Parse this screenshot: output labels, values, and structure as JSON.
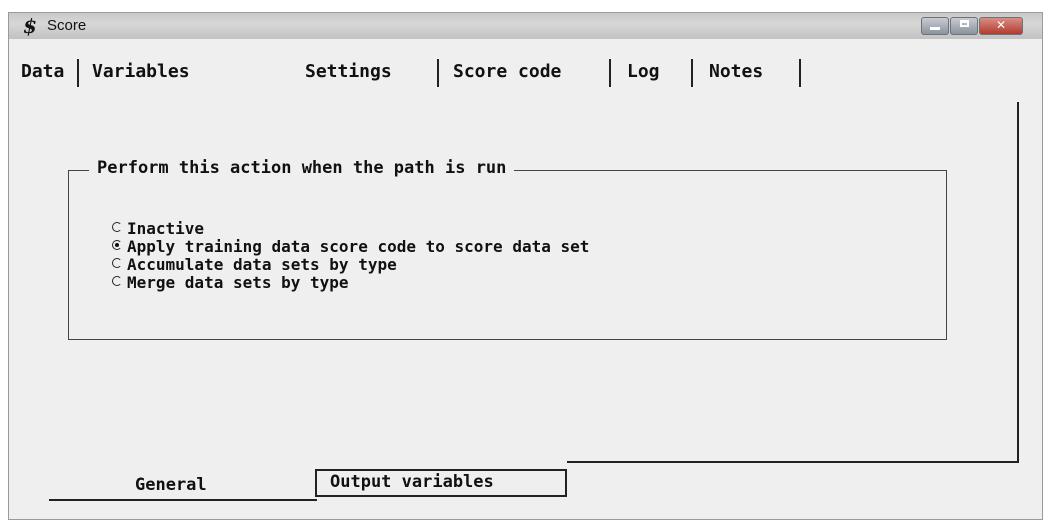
{
  "window": {
    "title": "Score",
    "icon": "sas-dollar-icon",
    "icon_glyph": "$",
    "controls": [
      "minimize",
      "maximize",
      "close"
    ]
  },
  "tabs": [
    {
      "label": "Data",
      "active": false
    },
    {
      "label": "Variables",
      "active": false
    },
    {
      "label": "Settings",
      "active": true
    },
    {
      "label": "Score code",
      "active": false
    },
    {
      "label": "Log",
      "active": false
    },
    {
      "label": "Notes",
      "active": false
    }
  ],
  "action_group": {
    "legend": "Perform this action when the path is run",
    "options": [
      {
        "label": "Inactive",
        "selected": false
      },
      {
        "label": "Apply training data score code to score data set",
        "selected": true
      },
      {
        "label": "Accumulate data sets by type",
        "selected": false
      },
      {
        "label": "Merge data sets by type",
        "selected": false
      }
    ]
  },
  "subtabs": [
    {
      "label": "General",
      "active": true
    },
    {
      "label": "Output variables",
      "active": false
    }
  ]
}
